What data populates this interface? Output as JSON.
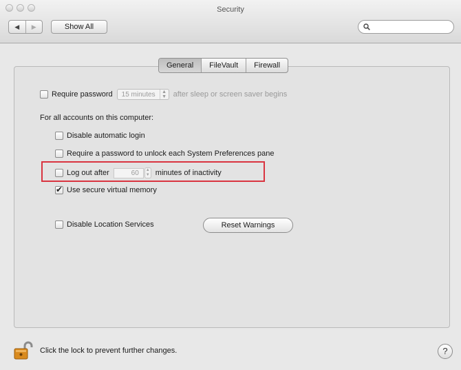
{
  "window": {
    "title": "Security"
  },
  "toolbar": {
    "back_icon": "◀",
    "forward_icon": "▶",
    "show_all_label": "Show All",
    "search_placeholder": ""
  },
  "tabs": [
    {
      "label": "General",
      "active": true
    },
    {
      "label": "FileVault",
      "active": false
    },
    {
      "label": "Firewall",
      "active": false
    }
  ],
  "general": {
    "require_password": {
      "label": "Require password",
      "checked": false,
      "interval": "15 minutes",
      "suffix": "after sleep or screen saver begins"
    },
    "accounts_heading": "For all accounts on this computer:",
    "disable_auto_login": {
      "label": "Disable automatic login",
      "checked": false
    },
    "require_pw_prefs": {
      "label": "Require a password to unlock each System Preferences pane",
      "checked": false
    },
    "logout": {
      "label": "Log out after",
      "checked": false,
      "minutes": "60",
      "suffix": "minutes of inactivity"
    },
    "secure_vm": {
      "label": "Use secure virtual memory",
      "checked": true
    },
    "location": {
      "label": "Disable Location Services",
      "checked": false
    },
    "reset_warnings_label": "Reset Warnings"
  },
  "footer": {
    "lock_text": "Click the lock to prevent further changes.",
    "help_label": "?"
  },
  "colors": {
    "highlight_border": "#d9333f",
    "lock_body": "#d98a1e"
  }
}
